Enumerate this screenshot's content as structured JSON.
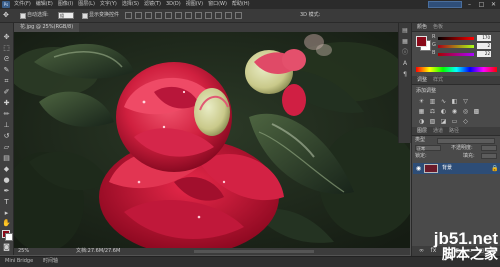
{
  "menubar": {
    "logo": "Ps",
    "items": [
      "文件(F)",
      "编辑(E)",
      "图像(I)",
      "图层(L)",
      "文字(Y)",
      "选择(S)",
      "滤镜(T)",
      "3D(D)",
      "视图(V)",
      "窗口(W)",
      "帮助(H)"
    ],
    "window_controls": [
      "–",
      "□",
      "✕"
    ]
  },
  "options_bar": {
    "tool_icon": "move-tool-icon",
    "auto_select_label": "自动选择:",
    "auto_select_value": "组",
    "show_transform_label": "显示变换控件",
    "mode_3d_label": "3D 模式:"
  },
  "document": {
    "tab_label": "花.jpg @ 25%(RGB/8)"
  },
  "status": {
    "zoom": "25%",
    "doc_size": "文档:27.6M/27.6M"
  },
  "bottom_bar": {
    "tabs": [
      "Mini Bridge",
      "时间轴"
    ]
  },
  "colors": {
    "foreground": "#8a0a1a",
    "background": "#ffffff",
    "selection": "#2d4d77"
  },
  "panels": {
    "color": {
      "tabs": [
        "颜色",
        "色板"
      ],
      "sliders": [
        {
          "label": "R",
          "value": "170"
        },
        {
          "label": "G",
          "value": "2"
        },
        {
          "label": "B",
          "value": "22"
        }
      ]
    },
    "adjustments": {
      "tabs": [
        "调整",
        "样式"
      ],
      "add_label": "添加调整"
    },
    "layers": {
      "tabs": [
        "图层",
        "通道",
        "路径"
      ],
      "kind_label": "类型",
      "blend_mode": "正常",
      "opacity_label": "不透明度:",
      "lock_label": "锁定:",
      "fill_label": "填充:",
      "layer_name": "背景"
    }
  },
  "watermark": {
    "url": "jb51.net",
    "name": "脚本之家"
  }
}
